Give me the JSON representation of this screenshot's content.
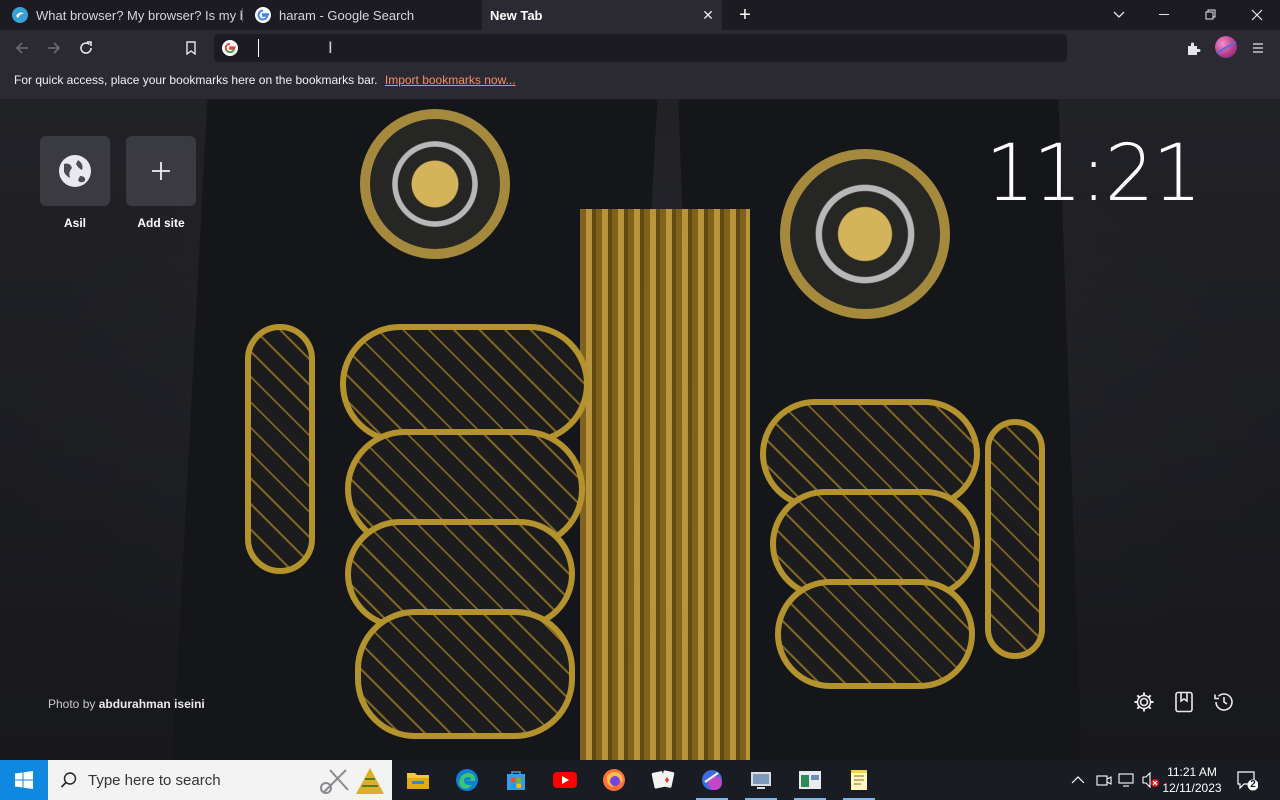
{
  "tabs": [
    {
      "title": "What browser? My browser? Is my bro",
      "favicon": "whatismybrowser-icon"
    },
    {
      "title": "haram - Google Search",
      "favicon": "google-icon"
    },
    {
      "title": "New Tab",
      "active": true
    }
  ],
  "window_controls": {
    "list_tabs": "chevron-down-icon",
    "minimize": "minimize-icon",
    "restore": "restore-icon",
    "close": "close-icon"
  },
  "toolbar": {
    "address_value": "",
    "address_placeholder": ""
  },
  "bookmarks_bar": {
    "message": "For quick access, place your bookmarks here on the bookmarks bar.",
    "import_link": "Import bookmarks now..."
  },
  "shortcuts": [
    {
      "label": "Asil",
      "icon": "globe-icon"
    },
    {
      "label": "Add site",
      "icon": "plus-icon"
    }
  ],
  "clock": "11:21",
  "photo_credit": {
    "prefix": "Photo by",
    "author": "abdurahman iseini"
  },
  "taskbar": {
    "search_placeholder": "Type here to search",
    "time": "11:21 AM",
    "date": "12/11/2023",
    "notification_count": "2"
  },
  "colors": {
    "accent": "#ff8a6a",
    "start": "#0f88e0",
    "toolbar": "#2b2a33"
  }
}
